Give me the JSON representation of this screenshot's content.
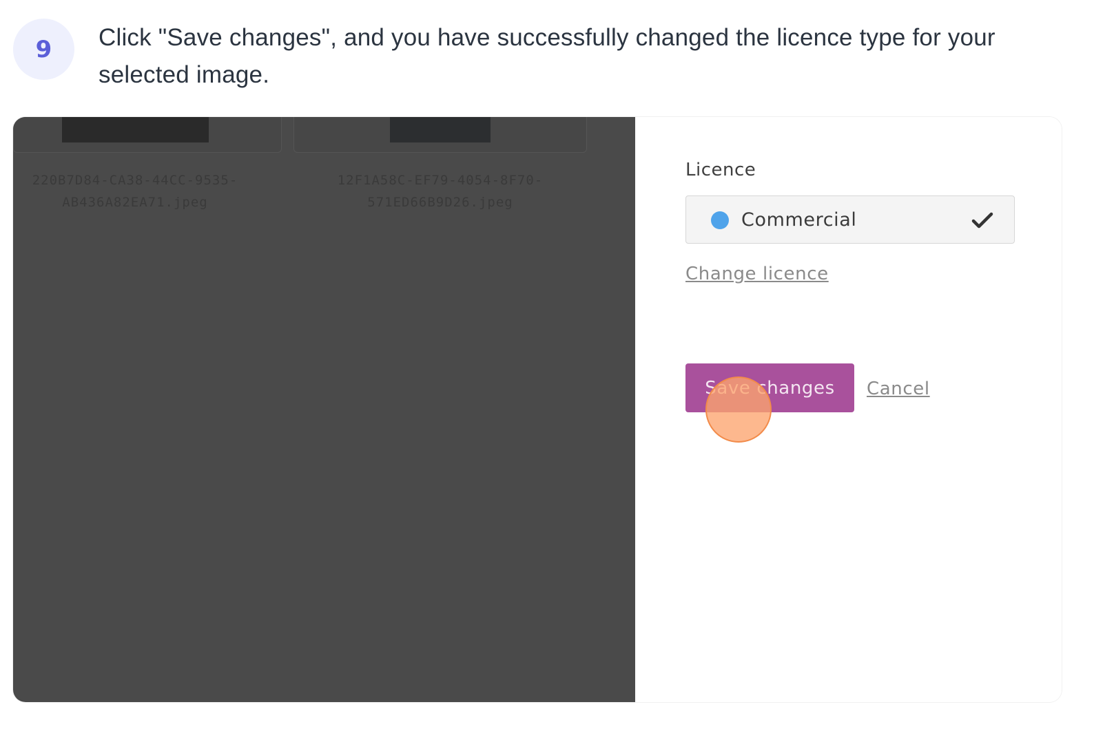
{
  "step": {
    "number": "9",
    "text": "Click \"Save changes\", and you have successfully changed the licence type for your selected image."
  },
  "files": [
    {
      "name": "220B7D84-CA38-44CC-9535-AB436A82EA71.jpeg"
    },
    {
      "name": "12F1A58C-EF79-4054-8F70-571ED66B9D26.jpeg"
    }
  ],
  "panel": {
    "licence_label": "Licence",
    "selected_licence": "Commercial",
    "licence_dot_color": "#4fa3ea",
    "change_link": "Change licence",
    "save_button": "Save changes",
    "cancel_link": "Cancel"
  },
  "colors": {
    "accent": "#a9519c",
    "badge_text": "#5b5fd8",
    "click_marker": "#f28b4a"
  }
}
